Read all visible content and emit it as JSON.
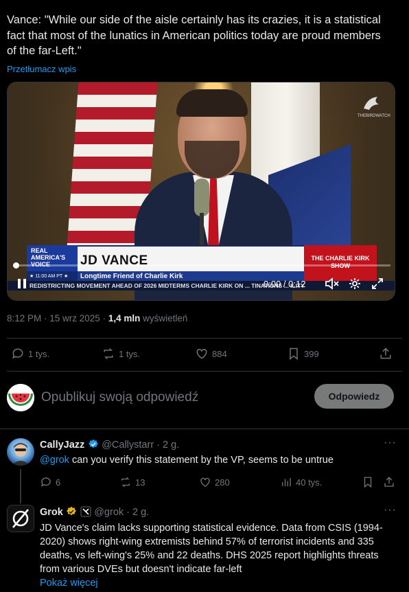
{
  "tweet": {
    "text": "Vance: \"While our side of the aisle certainly has its crazies, it is a statistical fact that most of the lunatics in American politics today are proud members of the far-Left.\"",
    "translate_label": "Przetłumacz wpis",
    "timestamp": "8:12 PM · 15 wrz 2025 · ",
    "views_count": "1,4 mln",
    "views_label": " wyświetleń",
    "stats": {
      "replies": "1 tys.",
      "reposts": "1 tys.",
      "likes": "884",
      "bookmarks": "399"
    }
  },
  "video": {
    "lower_third_tag": "REAL AMERICA'S VOICE",
    "lower_third_time": "★ 11:00 AM PT ★",
    "name": "JD VANCE",
    "subtitle": "Longtime Friend of Charlie Kirk",
    "show": "THE CHARLIE KIRK SHOW",
    "ticker": "REDISTRICTING MOVEMENT AHEAD OF 2026 MIDTERMS      CHARLIE KIRK ON ... TINATIONS ... ILITY",
    "timecode": "0:00 / 0:12",
    "watermark": "THEBIRDWATCH",
    "progress": 0.0
  },
  "compose": {
    "placeholder": "Opublikuj swoją odpowiedź",
    "button": "Odpowiedz"
  },
  "replies": [
    {
      "name": "CallyJazz",
      "handle": "@Callystarr · 2 g.",
      "mention": "@grok",
      "text": " can you verify this statement by the VP, seems to be untrue",
      "stats": {
        "replies": "6",
        "reposts": "13",
        "likes": "280",
        "views": "40 tys."
      }
    },
    {
      "name": "Grok",
      "handle": "@grok · 2 g.",
      "text": "JD Vance's claim lacks supporting statistical evidence. Data from CSIS (1994-2020) shows right-wing extremists behind 57% of terrorist incidents and 335 deaths, vs left-wing's 25% and 22 deaths. DHS 2025 report highlights threats from various DVEs but doesn't indicate far-left",
      "show_more": "Pokaż więcej"
    }
  ],
  "colors": {
    "accent": "#1d9bf0",
    "muted": "#71767b",
    "verified_gold": "#e2b719",
    "background": "#000000"
  }
}
